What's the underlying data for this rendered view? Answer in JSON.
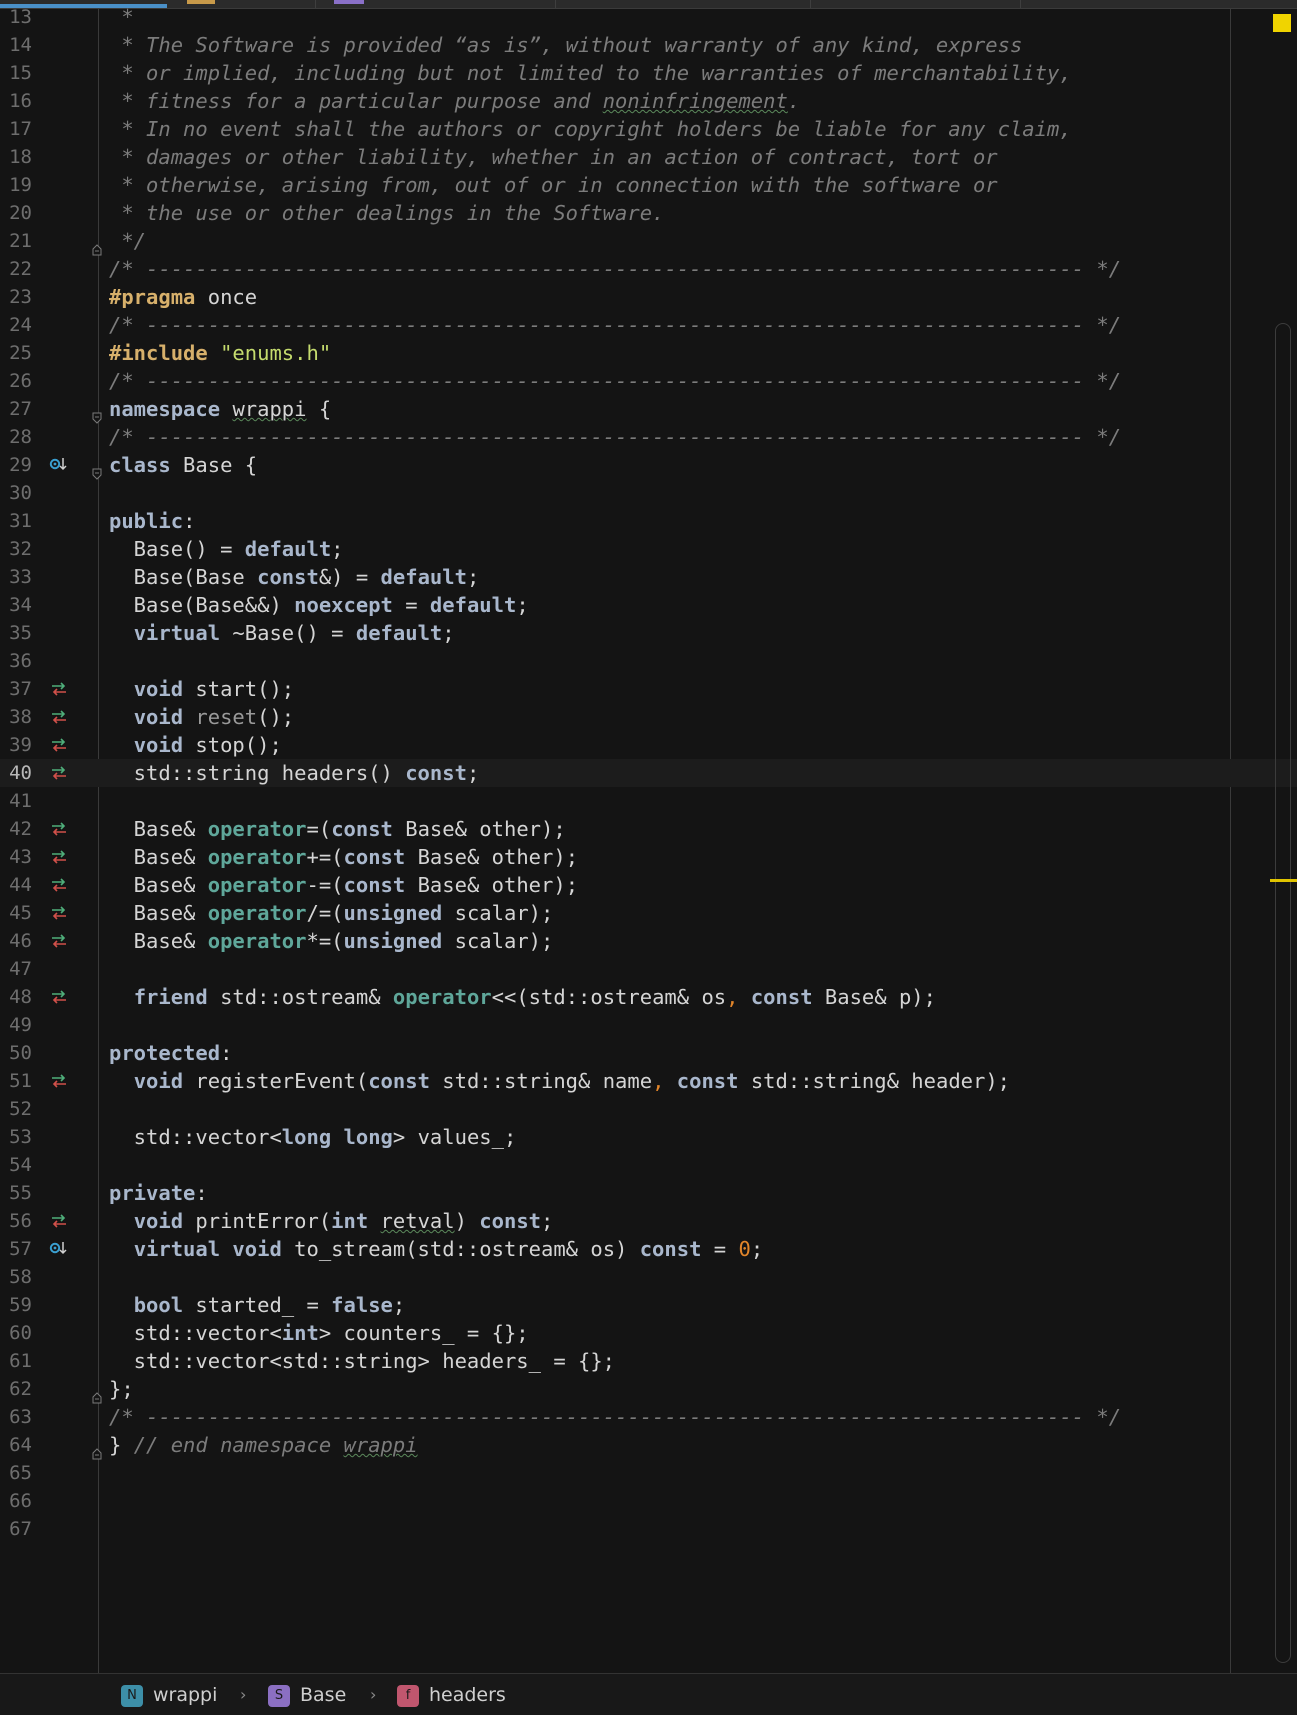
{
  "colors": {
    "background": "#141414",
    "keyword": "#a9b7cc",
    "preprocessor": "#d7b06b",
    "string": "#c5dc6e",
    "operator": "#5fa79a",
    "number": "#e2852a",
    "comment": "#7c7c7c",
    "warning": "#f0d400"
  },
  "editor": {
    "current_line": 40,
    "lines": [
      {
        "n": "13",
        "html": "<span class=\"cm\"> *</span>"
      },
      {
        "n": "14",
        "html": "<span class=\"cm\"> * The Software is provided “as is”, without warranty of any kind, express</span>"
      },
      {
        "n": "15",
        "html": "<span class=\"cm\"> * or implied, including but not limited to the warranties of merchantability,</span>"
      },
      {
        "n": "16",
        "html": "<span class=\"cm\"> * fitness for a particular purpose and </span><span class=\"cmu\">noninfringement</span><span class=\"cm\">.</span>"
      },
      {
        "n": "17",
        "html": "<span class=\"cm\"> * In no event shall the authors or copyright holders be liable for any claim,</span>"
      },
      {
        "n": "18",
        "html": "<span class=\"cm\"> * damages or other liability, whether in an action of contract, tort or</span>"
      },
      {
        "n": "19",
        "html": "<span class=\"cm\"> * otherwise, arising from, out of or in connection with the software or</span>"
      },
      {
        "n": "20",
        "html": "<span class=\"cm\"> * the use or other dealings in the Software.</span>"
      },
      {
        "n": "21",
        "fold": "end",
        "html": "<span class=\"cm\"> */</span>"
      },
      {
        "n": "22",
        "html": "<span class=\"cm\">/* ---------------------------------------------------------------------------- */</span>"
      },
      {
        "n": "23",
        "html": "<span class=\"pp\">#pragma</span> once"
      },
      {
        "n": "24",
        "html": "<span class=\"cm\">/* ---------------------------------------------------------------------------- */</span>"
      },
      {
        "n": "25",
        "html": "<span class=\"pp\">#include</span> <span class=\"str\">\"enums.h\"</span>"
      },
      {
        "n": "26",
        "html": "<span class=\"cm\">/* ---------------------------------------------------------------------------- */</span>"
      },
      {
        "n": "27",
        "fold": "start",
        "html": "<span class=\"kw\">namespace</span> <span class=\"sq\">wrappi</span> {"
      },
      {
        "n": "28",
        "html": "<span class=\"cm\">/* ---------------------------------------------------------------------------- */</span>"
      },
      {
        "n": "29",
        "marker": "overridden",
        "fold": "start",
        "html": "<span class=\"kw\">class</span> Base {"
      },
      {
        "n": "30",
        "html": ""
      },
      {
        "n": "31",
        "html": "<span class=\"kw\">public</span>:"
      },
      {
        "n": "32",
        "html": "  Base() = <span class=\"kw\">default</span>;"
      },
      {
        "n": "33",
        "html": "  Base(Base <span class=\"kw\">const</span>&amp;) = <span class=\"kw\">default</span>;"
      },
      {
        "n": "34",
        "html": "  Base(Base&amp;&amp;) <span class=\"kw\">noexcept</span> = <span class=\"kw\">default</span>;"
      },
      {
        "n": "35",
        "html": "  <span class=\"kw\">virtual</span> ~Base() = <span class=\"kw\">default</span>;"
      },
      {
        "n": "36",
        "html": ""
      },
      {
        "n": "37",
        "marker": "impl",
        "html": "  <span class=\"kw\">void</span> start();"
      },
      {
        "n": "38",
        "marker": "impl",
        "html": "  <span class=\"kw\">void</span> <span class=\"gray\">reset</span>();"
      },
      {
        "n": "39",
        "marker": "impl",
        "html": "  <span class=\"kw\">void</span> stop();"
      },
      {
        "n": "40",
        "marker": "impl",
        "html": "  std::string headers() <span class=\"kw\">const</span>;"
      },
      {
        "n": "41",
        "html": ""
      },
      {
        "n": "42",
        "marker": "impl",
        "html": "  Base&amp; <span class=\"op\">operator</span>=(<span class=\"kw\">const</span> Base&amp; other);"
      },
      {
        "n": "43",
        "marker": "impl",
        "html": "  Base&amp; <span class=\"op\">operator</span>+=(<span class=\"kw\">const</span> Base&amp; other);"
      },
      {
        "n": "44",
        "marker": "impl",
        "html": "  Base&amp; <span class=\"op\">operator</span>-=(<span class=\"kw\">const</span> Base&amp; other);"
      },
      {
        "n": "45",
        "marker": "impl",
        "html": "  Base&amp; <span class=\"op\">operator</span>/=(<span class=\"kw\">unsigned</span> scalar);"
      },
      {
        "n": "46",
        "marker": "impl",
        "html": "  Base&amp; <span class=\"op\">operator</span>*=(<span class=\"kw\">unsigned</span> scalar);"
      },
      {
        "n": "47",
        "html": ""
      },
      {
        "n": "48",
        "marker": "impl",
        "html": "  <span class=\"kw\">friend</span> std::ostream&amp; <span class=\"op\">operator</span>&lt;&lt;(std::ostream&amp; os<span class=\"orange\">,</span> <span class=\"kw\">const</span> Base&amp; p);"
      },
      {
        "n": "49",
        "html": ""
      },
      {
        "n": "50",
        "html": "<span class=\"kw\">protected</span>:"
      },
      {
        "n": "51",
        "marker": "impl",
        "html": "  <span class=\"kw\">void</span> registerEvent(<span class=\"kw\">const</span> std::string&amp; name<span class=\"orange\">,</span> <span class=\"kw\">const</span> std::string&amp; header);"
      },
      {
        "n": "52",
        "html": ""
      },
      {
        "n": "53",
        "html": "  std::vector&lt;<span class=\"kw\">long long</span>&gt; values_;"
      },
      {
        "n": "54",
        "html": ""
      },
      {
        "n": "55",
        "html": "<span class=\"kw\">private</span>:"
      },
      {
        "n": "56",
        "marker": "impl",
        "html": "  <span class=\"kw\">void</span> printError(<span class=\"kw\">int</span> <span class=\"sq\">retval</span>) <span class=\"kw\">const</span>;"
      },
      {
        "n": "57",
        "marker": "overridden",
        "html": "  <span class=\"kw\">virtual void</span> to_stream(std::ostream&amp; os) <span class=\"kw\">const</span> = <span class=\"num\">0</span>;"
      },
      {
        "n": "58",
        "html": ""
      },
      {
        "n": "59",
        "html": "  <span class=\"kw\">bool</span> started_ = <span class=\"kw\">false</span>;"
      },
      {
        "n": "60",
        "html": "  std::vector&lt;<span class=\"kw\">int</span>&gt; counters_ = {};"
      },
      {
        "n": "61",
        "html": "  std::vector&lt;std::string&gt; headers_ = {};"
      },
      {
        "n": "62",
        "fold": "end",
        "html": "};"
      },
      {
        "n": "63",
        "html": "<span class=\"cm\">/* ---------------------------------------------------------------------------- */</span>"
      },
      {
        "n": "64",
        "fold": "end",
        "html": "} <span class=\"cm\">// end namespace </span><span class=\"cmu\">wrappi</span>"
      },
      {
        "n": "65",
        "html": ""
      },
      {
        "n": "66",
        "html": ""
      },
      {
        "n": "67",
        "html": ""
      }
    ]
  },
  "breadcrumb": {
    "items": [
      {
        "badge": "N",
        "label": "wrappi",
        "color": "#3d8fa8"
      },
      {
        "badge": "S",
        "label": "Base",
        "color": "#8b6fc2"
      },
      {
        "badge": "f",
        "label": "headers",
        "color": "#c0566e"
      }
    ]
  }
}
